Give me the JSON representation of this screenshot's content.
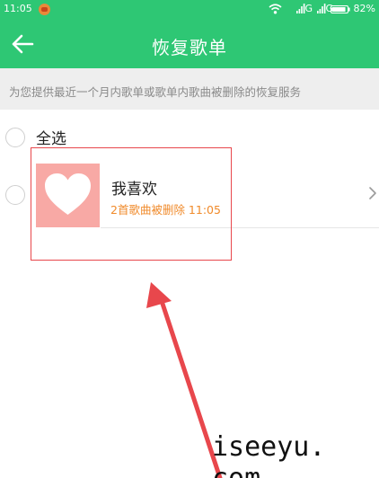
{
  "status_bar": {
    "time": "11:05",
    "app_icon": "notification-app-icon",
    "signal_1_label": "G",
    "signal_2_label": "G",
    "battery_percent": "82%"
  },
  "app_bar": {
    "back_icon": "arrow-left-icon",
    "title": "恢复歌单"
  },
  "notice": {
    "text": "为您提供最近一个月内歌单或歌单内歌曲被删除的恢复服务"
  },
  "select_all": {
    "label": "全选",
    "checked": false
  },
  "playlist": {
    "name": "我喜欢",
    "meta": "2首歌曲被删除 11:05",
    "cover_icon": "heart-icon",
    "cover_color": "#f8a9a5",
    "meta_color": "#f08a2a",
    "checked": false
  },
  "colors": {
    "accent": "#2ec774",
    "annotation": "#e8474c"
  },
  "watermark": "iseeyu. com"
}
